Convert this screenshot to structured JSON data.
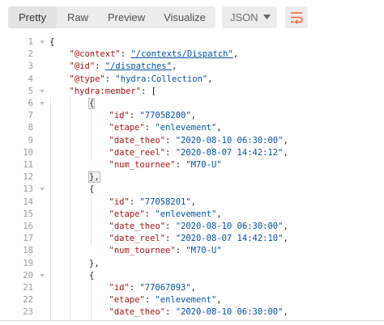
{
  "toolbar": {
    "tabs": [
      {
        "label": "Pretty",
        "active": true
      },
      {
        "label": "Raw",
        "active": false
      },
      {
        "label": "Preview",
        "active": false
      },
      {
        "label": "Visualize",
        "active": false
      }
    ],
    "format_select": {
      "value": "JSON"
    },
    "wrap_icon": "wrap-lines-icon"
  },
  "colors": {
    "key": "#a31515",
    "string": "#0451a5",
    "punct": "#222222",
    "line_number": "#9a9a9a",
    "accent": "#f26b3a"
  },
  "code": {
    "lines": [
      {
        "n": "1",
        "parts": [
          {
            "c": "p",
            "t": "{"
          }
        ]
      },
      {
        "n": "2",
        "parts": [
          {
            "c": "k",
            "t": "\"@context\""
          },
          {
            "c": "p",
            "t": ": "
          },
          {
            "c": "s",
            "t": "\"/contexts/Dispatch\""
          },
          {
            "c": "p",
            "t": ","
          }
        ]
      },
      {
        "n": "3",
        "parts": [
          {
            "c": "k",
            "t": "\"@id\""
          },
          {
            "c": "p",
            "t": ": "
          },
          {
            "c": "s",
            "t": "\"/dispatches\""
          },
          {
            "c": "p",
            "t": ","
          }
        ]
      },
      {
        "n": "4",
        "parts": [
          {
            "c": "k",
            "t": "\"@type\""
          },
          {
            "c": "p",
            "t": ": "
          },
          {
            "c": "s",
            "t": "\"hydra:Collection\""
          },
          {
            "c": "p",
            "t": ","
          }
        ]
      },
      {
        "n": "5",
        "parts": [
          {
            "c": "k",
            "t": "\"hydra:member\""
          },
          {
            "c": "p",
            "t": ": ["
          }
        ]
      },
      {
        "n": "6",
        "parts": [
          {
            "c": "p",
            "t": "{"
          }
        ]
      },
      {
        "n": "7",
        "parts": [
          {
            "c": "k",
            "t": "\"id\""
          },
          {
            "c": "p",
            "t": ": "
          },
          {
            "c": "s",
            "t": "\"77058200\""
          },
          {
            "c": "p",
            "t": ","
          }
        ]
      },
      {
        "n": "8",
        "parts": [
          {
            "c": "k",
            "t": "\"etape\""
          },
          {
            "c": "p",
            "t": ": "
          },
          {
            "c": "s",
            "t": "\"enlevement\""
          },
          {
            "c": "p",
            "t": ","
          }
        ]
      },
      {
        "n": "9",
        "parts": [
          {
            "c": "k",
            "t": "\"date_theo\""
          },
          {
            "c": "p",
            "t": ": "
          },
          {
            "c": "s",
            "t": "\"2020-08-10 06:30:00\""
          },
          {
            "c": "p",
            "t": ","
          }
        ]
      },
      {
        "n": "10",
        "parts": [
          {
            "c": "k",
            "t": "\"date_reel\""
          },
          {
            "c": "p",
            "t": ": "
          },
          {
            "c": "s",
            "t": "\"2020-08-07 14:42:12\""
          },
          {
            "c": "p",
            "t": ","
          }
        ]
      },
      {
        "n": "11",
        "parts": [
          {
            "c": "k",
            "t": "\"num_tournee\""
          },
          {
            "c": "p",
            "t": ": "
          },
          {
            "c": "s",
            "t": "\"M70-U\""
          }
        ]
      },
      {
        "n": "12",
        "parts": [
          {
            "c": "p",
            "t": "},"
          }
        ]
      },
      {
        "n": "13",
        "parts": [
          {
            "c": "p",
            "t": "{"
          }
        ]
      },
      {
        "n": "14",
        "parts": [
          {
            "c": "k",
            "t": "\"id\""
          },
          {
            "c": "p",
            "t": ": "
          },
          {
            "c": "s",
            "t": "\"77058201\""
          },
          {
            "c": "p",
            "t": ","
          }
        ]
      },
      {
        "n": "15",
        "parts": [
          {
            "c": "k",
            "t": "\"etape\""
          },
          {
            "c": "p",
            "t": ": "
          },
          {
            "c": "s",
            "t": "\"enlevement\""
          },
          {
            "c": "p",
            "t": ","
          }
        ]
      },
      {
        "n": "16",
        "parts": [
          {
            "c": "k",
            "t": "\"date_theo\""
          },
          {
            "c": "p",
            "t": ": "
          },
          {
            "c": "s",
            "t": "\"2020-08-10 06:30:00\""
          },
          {
            "c": "p",
            "t": ","
          }
        ]
      },
      {
        "n": "17",
        "parts": [
          {
            "c": "k",
            "t": "\"date_reel\""
          },
          {
            "c": "p",
            "t": ": "
          },
          {
            "c": "s",
            "t": "\"2020-08-07 14:42:10\""
          },
          {
            "c": "p",
            "t": ","
          }
        ]
      },
      {
        "n": "18",
        "parts": [
          {
            "c": "k",
            "t": "\"num_tournee\""
          },
          {
            "c": "p",
            "t": ": "
          },
          {
            "c": "s",
            "t": "\"M70-U\""
          }
        ]
      },
      {
        "n": "19",
        "parts": [
          {
            "c": "p",
            "t": "},"
          }
        ]
      },
      {
        "n": "20",
        "parts": [
          {
            "c": "p",
            "t": "{"
          }
        ]
      },
      {
        "n": "21",
        "parts": [
          {
            "c": "k",
            "t": "\"id\""
          },
          {
            "c": "p",
            "t": ": "
          },
          {
            "c": "s",
            "t": "\"77067093\""
          },
          {
            "c": "p",
            "t": ","
          }
        ]
      },
      {
        "n": "22",
        "parts": [
          {
            "c": "k",
            "t": "\"etape\""
          },
          {
            "c": "p",
            "t": ": "
          },
          {
            "c": "s",
            "t": "\"enlevement\""
          },
          {
            "c": "p",
            "t": ","
          }
        ]
      },
      {
        "n": "23",
        "parts": [
          {
            "c": "k",
            "t": "\"date_theo\""
          },
          {
            "c": "p",
            "t": ": "
          },
          {
            "c": "s",
            "t": "\"2020-08-10 06:30:00\""
          },
          {
            "c": "p",
            "t": ","
          }
        ]
      }
    ]
  }
}
